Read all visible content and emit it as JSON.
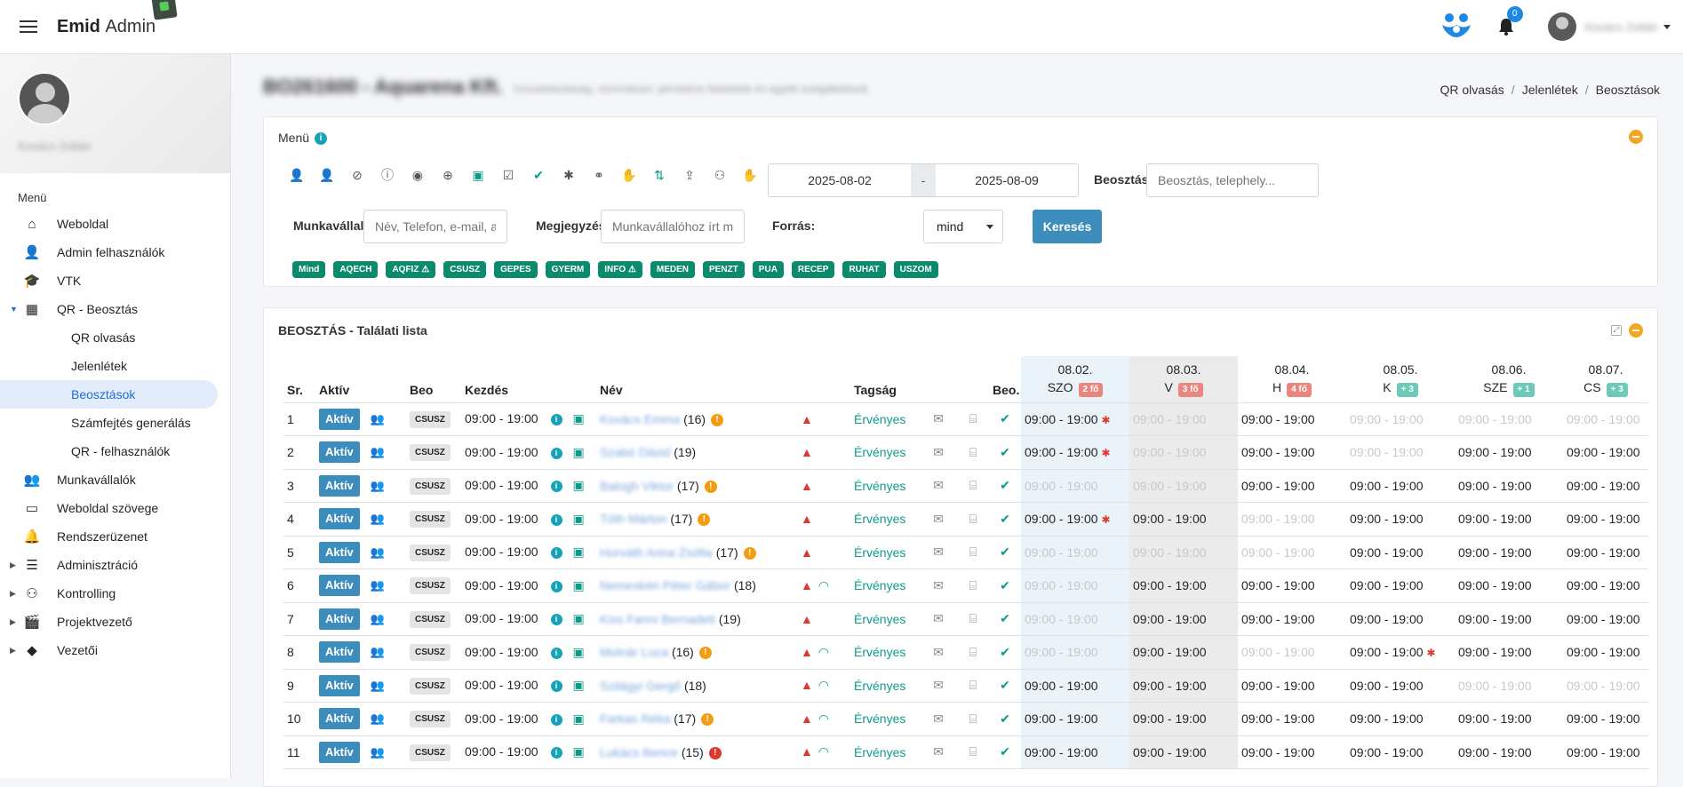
{
  "app": {
    "brand_bold": "Emid",
    "brand_rest": "Admin",
    "notif_count": "0",
    "user_name": "Kovács Zoltán"
  },
  "sidebar": {
    "user_name": "Kovács Zoltán",
    "menu_heading": "Menü",
    "items": [
      {
        "label": "Weboldal",
        "icon": "home-icon"
      },
      {
        "label": "Admin felhasználók",
        "icon": "user-check-icon"
      },
      {
        "label": "VTK",
        "icon": "graduation-icon"
      },
      {
        "label": "QR - Beosztás",
        "icon": "qr-icon",
        "expanded": true
      },
      {
        "label": "Munkavállalók",
        "icon": "users-icon"
      },
      {
        "label": "Weboldal szövege",
        "icon": "screen-icon"
      },
      {
        "label": "Rendszerüzenet",
        "icon": "bell-icon"
      },
      {
        "label": "Adminisztráció",
        "icon": "sliders-icon"
      },
      {
        "label": "Kontrolling",
        "icon": "team-icon"
      },
      {
        "label": "Projektvezető",
        "icon": "clapper-icon"
      },
      {
        "label": "Vezetői",
        "icon": "diamond-icon"
      }
    ],
    "subitems": [
      "QR olvasás",
      "Jelenlétek",
      "Beosztások",
      "Számfejtés generálás",
      "QR - felhasználók"
    ]
  },
  "page": {
    "title": "BO261600 - Aquarena Kft.",
    "subtitle": "Uszodatisztaság, vízrendszer, pénztáros feladatok és egyéb szolgáltatások",
    "breadcrumbs": [
      "QR olvasás",
      "Jelenlétek",
      "Beosztások"
    ]
  },
  "filter": {
    "title": "Menü",
    "date_from": "2025-08-02",
    "date_sep": "-",
    "date_to": "2025-08-09",
    "beosztas_label": "Beosztás",
    "beosztas_placeholder": "Beosztás, telephely...",
    "munkavallalo_label": "Munkavállaló",
    "munkavallalo_placeholder": "Név, Telefon, e-mail, adó",
    "megjegyzes_label": "Megjegyzés",
    "megjegyzes_placeholder": "Munkavállalóhoz írt megjegyzés",
    "forras_label": "Forrás:",
    "forras_value": "mind",
    "search_button": "Keresés",
    "chips": [
      "Mind",
      "AQECH",
      "AQFIZ ⚠",
      "CSUSZ",
      "GEPES",
      "GYERM",
      "INFO ⚠",
      "MEDEN",
      "PENZT",
      "PUA",
      "RECEP",
      "RUHAT",
      "USZOM"
    ]
  },
  "results": {
    "title": "BEOSZTÁS - Találati lista",
    "headers": {
      "sr": "Sr.",
      "aktiv": "Aktív",
      "beo": "Beo",
      "kezdes": "Kezdés",
      "nev": "Név",
      "tagsag": "Tagság",
      "beo2": "Beo."
    },
    "days": [
      {
        "date": "08.02.",
        "dow": "SZO",
        "badge": "2 fő",
        "badge_color": "#e9877f"
      },
      {
        "date": "08.03.",
        "dow": "V",
        "badge": "3 fő",
        "badge_color": "#e9877f"
      },
      {
        "date": "08.04.",
        "dow": "H",
        "badge": "4 fő",
        "badge_color": "#e9877f"
      },
      {
        "date": "08.05.",
        "dow": "K",
        "badge": "+ 3",
        "badge_color": "#6dc9b8"
      },
      {
        "date": "08.06.",
        "dow": "SZE",
        "badge": "+ 1",
        "badge_color": "#6dc9b8"
      },
      {
        "date": "08.07.",
        "dow": "CS",
        "badge": "+ 3",
        "badge_color": "#6dc9b8"
      }
    ],
    "rows": [
      {
        "sr": "1",
        "status": "Aktív",
        "beo": "CSUSZ",
        "kezdes": "09:00 - 19:00",
        "name": "Kovács Emma",
        "age": "(16)",
        "flag": "orange",
        "wifi": false,
        "tagsag": "Érvényes",
        "cells": [
          {
            "t": "09:00 - 19:00",
            "on": true,
            "bug": true
          },
          {
            "t": "09:00 - 19:00",
            "on": false
          },
          {
            "t": "09:00 - 19:00",
            "on": true
          },
          {
            "t": "09:00 - 19:00",
            "on": false
          },
          {
            "t": "09:00 - 19:00",
            "on": false
          },
          {
            "t": "09:00 - 19:00",
            "on": false
          }
        ]
      },
      {
        "sr": "2",
        "status": "Aktív",
        "beo": "CSUSZ",
        "kezdes": "09:00 - 19:00",
        "name": "Szabó Dávid",
        "age": "(19)",
        "flag": "",
        "wifi": false,
        "tagsag": "Érvényes",
        "cells": [
          {
            "t": "09:00 - 19:00",
            "on": true,
            "bug": true
          },
          {
            "t": "09:00 - 19:00",
            "on": false
          },
          {
            "t": "09:00 - 19:00",
            "on": true
          },
          {
            "t": "09:00 - 19:00",
            "on": false
          },
          {
            "t": "09:00 - 19:00",
            "on": true
          },
          {
            "t": "09:00 - 19:00",
            "on": true
          }
        ]
      },
      {
        "sr": "3",
        "status": "Aktív",
        "beo": "CSUSZ",
        "kezdes": "09:00 - 19:00",
        "name": "Balogh Viktor",
        "age": "(17)",
        "flag": "orange",
        "wifi": false,
        "tagsag": "Érvényes",
        "cells": [
          {
            "t": "09:00 - 19:00",
            "on": false
          },
          {
            "t": "09:00 - 19:00",
            "on": false
          },
          {
            "t": "09:00 - 19:00",
            "on": true
          },
          {
            "t": "09:00 - 19:00",
            "on": true
          },
          {
            "t": "09:00 - 19:00",
            "on": true
          },
          {
            "t": "09:00 - 19:00",
            "on": true
          }
        ]
      },
      {
        "sr": "4",
        "status": "Aktív",
        "beo": "CSUSZ",
        "kezdes": "09:00 - 19:00",
        "name": "Tóth Márton",
        "age": "(17)",
        "flag": "orange",
        "wifi": false,
        "tagsag": "Érvényes",
        "cells": [
          {
            "t": "09:00 - 19:00",
            "on": true,
            "bug": true
          },
          {
            "t": "09:00 - 19:00",
            "on": true
          },
          {
            "t": "09:00 - 19:00",
            "on": false
          },
          {
            "t": "09:00 - 19:00",
            "on": true
          },
          {
            "t": "09:00 - 19:00",
            "on": true
          },
          {
            "t": "09:00 - 19:00",
            "on": true
          }
        ]
      },
      {
        "sr": "5",
        "status": "Aktív",
        "beo": "CSUSZ",
        "kezdes": "09:00 - 19:00",
        "name": "Horváth Anna Zsófia",
        "age": "(17)",
        "flag": "orange",
        "wifi": false,
        "tagsag": "Érvényes",
        "cells": [
          {
            "t": "09:00 - 19:00",
            "on": false
          },
          {
            "t": "09:00 - 19:00",
            "on": false
          },
          {
            "t": "09:00 - 19:00",
            "on": false
          },
          {
            "t": "09:00 - 19:00",
            "on": true
          },
          {
            "t": "09:00 - 19:00",
            "on": true
          },
          {
            "t": "09:00 - 19:00",
            "on": true
          }
        ]
      },
      {
        "sr": "6",
        "status": "Aktív",
        "beo": "CSUSZ",
        "kezdes": "09:00 - 19:00",
        "name": "Nemeskéri Péter Gábor",
        "age": "(18)",
        "flag": "",
        "wifi": true,
        "tagsag": "Érvényes",
        "cells": [
          {
            "t": "09:00 - 19:00",
            "on": false
          },
          {
            "t": "09:00 - 19:00",
            "on": true
          },
          {
            "t": "09:00 - 19:00",
            "on": true
          },
          {
            "t": "09:00 - 19:00",
            "on": true
          },
          {
            "t": "09:00 - 19:00",
            "on": true
          },
          {
            "t": "09:00 - 19:00",
            "on": true
          }
        ]
      },
      {
        "sr": "7",
        "status": "Aktív",
        "beo": "CSUSZ",
        "kezdes": "09:00 - 19:00",
        "name": "Kiss Fanni Bernadett",
        "age": "(19)",
        "flag": "",
        "wifi": false,
        "tagsag": "Érvényes",
        "cells": [
          {
            "t": "09:00 - 19:00",
            "on": false
          },
          {
            "t": "09:00 - 19:00",
            "on": true
          },
          {
            "t": "09:00 - 19:00",
            "on": true
          },
          {
            "t": "09:00 - 19:00",
            "on": true
          },
          {
            "t": "09:00 - 19:00",
            "on": true
          },
          {
            "t": "09:00 - 19:00",
            "on": true
          }
        ]
      },
      {
        "sr": "8",
        "status": "Aktív",
        "beo": "CSUSZ",
        "kezdes": "09:00 - 19:00",
        "name": "Molnár Luca",
        "age": "(16)",
        "flag": "orange",
        "wifi": true,
        "tagsag": "Érvényes",
        "cells": [
          {
            "t": "09:00 - 19:00",
            "on": false
          },
          {
            "t": "09:00 - 19:00",
            "on": true
          },
          {
            "t": "09:00 - 19:00",
            "on": false
          },
          {
            "t": "09:00 - 19:00",
            "on": true,
            "bug": true
          },
          {
            "t": "09:00 - 19:00",
            "on": true
          },
          {
            "t": "09:00 - 19:00",
            "on": true
          }
        ]
      },
      {
        "sr": "9",
        "status": "Aktív",
        "beo": "CSUSZ",
        "kezdes": "09:00 - 19:00",
        "name": "Szilágyi Gergő",
        "age": "(18)",
        "flag": "",
        "wifi": true,
        "tagsag": "Érvényes",
        "cells": [
          {
            "t": "09:00 - 19:00",
            "on": true
          },
          {
            "t": "09:00 - 19:00",
            "on": true
          },
          {
            "t": "09:00 - 19:00",
            "on": true
          },
          {
            "t": "09:00 - 19:00",
            "on": true
          },
          {
            "t": "09:00 - 19:00",
            "on": false
          },
          {
            "t": "09:00 - 19:00",
            "on": false
          }
        ]
      },
      {
        "sr": "10",
        "status": "Aktív",
        "beo": "CSUSZ",
        "kezdes": "09:00 - 19:00",
        "name": "Farkas Réka",
        "age": "(17)",
        "flag": "orange",
        "wifi": true,
        "tagsag": "Érvényes",
        "cells": [
          {
            "t": "09:00 - 19:00",
            "on": true
          },
          {
            "t": "09:00 - 19:00",
            "on": true
          },
          {
            "t": "09:00 - 19:00",
            "on": true
          },
          {
            "t": "09:00 - 19:00",
            "on": true
          },
          {
            "t": "09:00 - 19:00",
            "on": true
          },
          {
            "t": "09:00 - 19:00",
            "on": true
          }
        ]
      },
      {
        "sr": "11",
        "status": "Aktív",
        "beo": "CSUSZ",
        "kezdes": "09:00 - 19:00",
        "name": "Lukács Bence",
        "age": "(15)",
        "flag": "red",
        "wifi": true,
        "tagsag": "Érvényes",
        "cells": [
          {
            "t": "09:00 - 19:00",
            "on": true
          },
          {
            "t": "09:00 - 19:00",
            "on": true
          },
          {
            "t": "09:00 - 19:00",
            "on": true
          },
          {
            "t": "09:00 - 19:00",
            "on": true
          },
          {
            "t": "09:00 - 19:00",
            "on": true
          },
          {
            "t": "09:00 - 19:00",
            "on": true
          }
        ]
      }
    ]
  }
}
